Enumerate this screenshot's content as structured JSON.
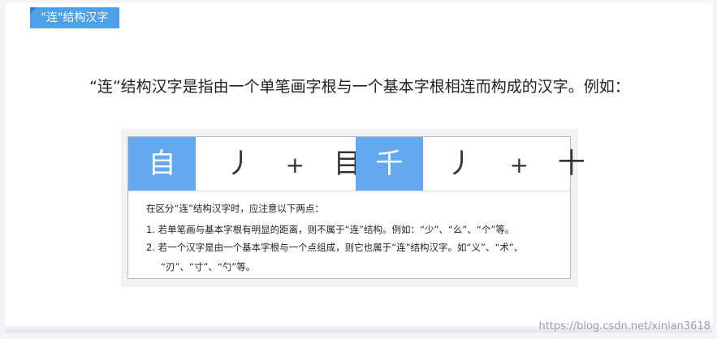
{
  "tag": {
    "label": "\"连\"结构汉字"
  },
  "intro": {
    "text": "“连”结构汉字是指由一个单笔画字根与一个基本字根相连而构成的汉字。例如："
  },
  "examples": [
    {
      "char": "自",
      "parts": [
        "丿",
        "+",
        "目"
      ]
    },
    {
      "char": "千",
      "parts": [
        "丿",
        "+",
        "十"
      ]
    }
  ],
  "notes": {
    "heading": "在区分“连”结构汉字时，应注意以下两点：",
    "item1": "1. 若单笔画与基本字根有明显的距离，则不属于“连”结构。例如：“少”、“么”、“个”等。",
    "item2_line1": "2. 若一个汉字是由一个基本字根与一个点组成，则它也属于“连”结构汉字。如“义”、“术”、",
    "item2_line2": "“刃”、“寸”、“勺”等。"
  },
  "watermark": "https://blog.csdn.net/xinlan3618",
  "colors": {
    "accent": "#4ea1e8",
    "cell_blue": "#64a9ee"
  }
}
